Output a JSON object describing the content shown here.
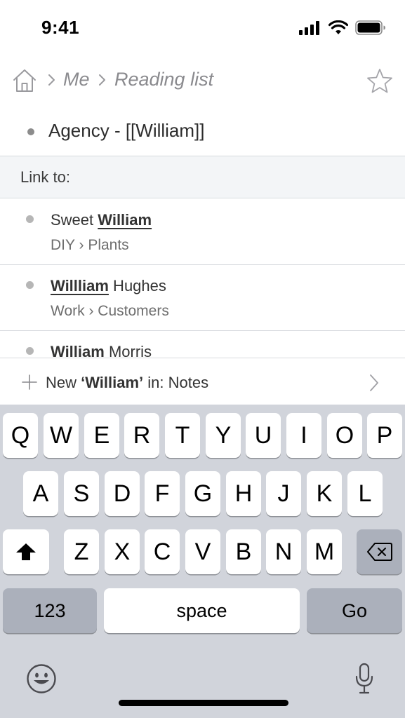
{
  "status_bar": {
    "time": "9:41"
  },
  "breadcrumb": {
    "items": [
      "Me",
      "Reading list"
    ]
  },
  "current_item": {
    "text": "Agency - [[William]]"
  },
  "popup": {
    "header": "Link to:",
    "suggestions": [
      {
        "prefix": "Sweet ",
        "match": "William",
        "suffix": "",
        "path": [
          "DIY",
          "Plants"
        ]
      },
      {
        "prefix": "",
        "match": "Willliam",
        "suffix": " Hughes",
        "path": [
          "Work",
          "Customers"
        ]
      },
      {
        "prefix": "",
        "match": "William",
        "suffix": " Morris",
        "path": []
      }
    ],
    "new_item": {
      "label_prefix": "New ",
      "label_match": "‘William’",
      "label_suffix": " in: Notes"
    }
  },
  "keyboard": {
    "row1": [
      "Q",
      "W",
      "E",
      "R",
      "T",
      "Y",
      "U",
      "I",
      "O",
      "P"
    ],
    "row2": [
      "A",
      "S",
      "D",
      "F",
      "G",
      "H",
      "J",
      "K",
      "L"
    ],
    "row3": [
      "Z",
      "X",
      "C",
      "V",
      "B",
      "N",
      "M"
    ],
    "numbers_key": "123",
    "space_key": "space",
    "go_key": "Go"
  },
  "colors": {
    "keyboard_bg": "#d1d4db",
    "dark_key": "#abb0bb",
    "muted_text": "#8a8a8e"
  }
}
